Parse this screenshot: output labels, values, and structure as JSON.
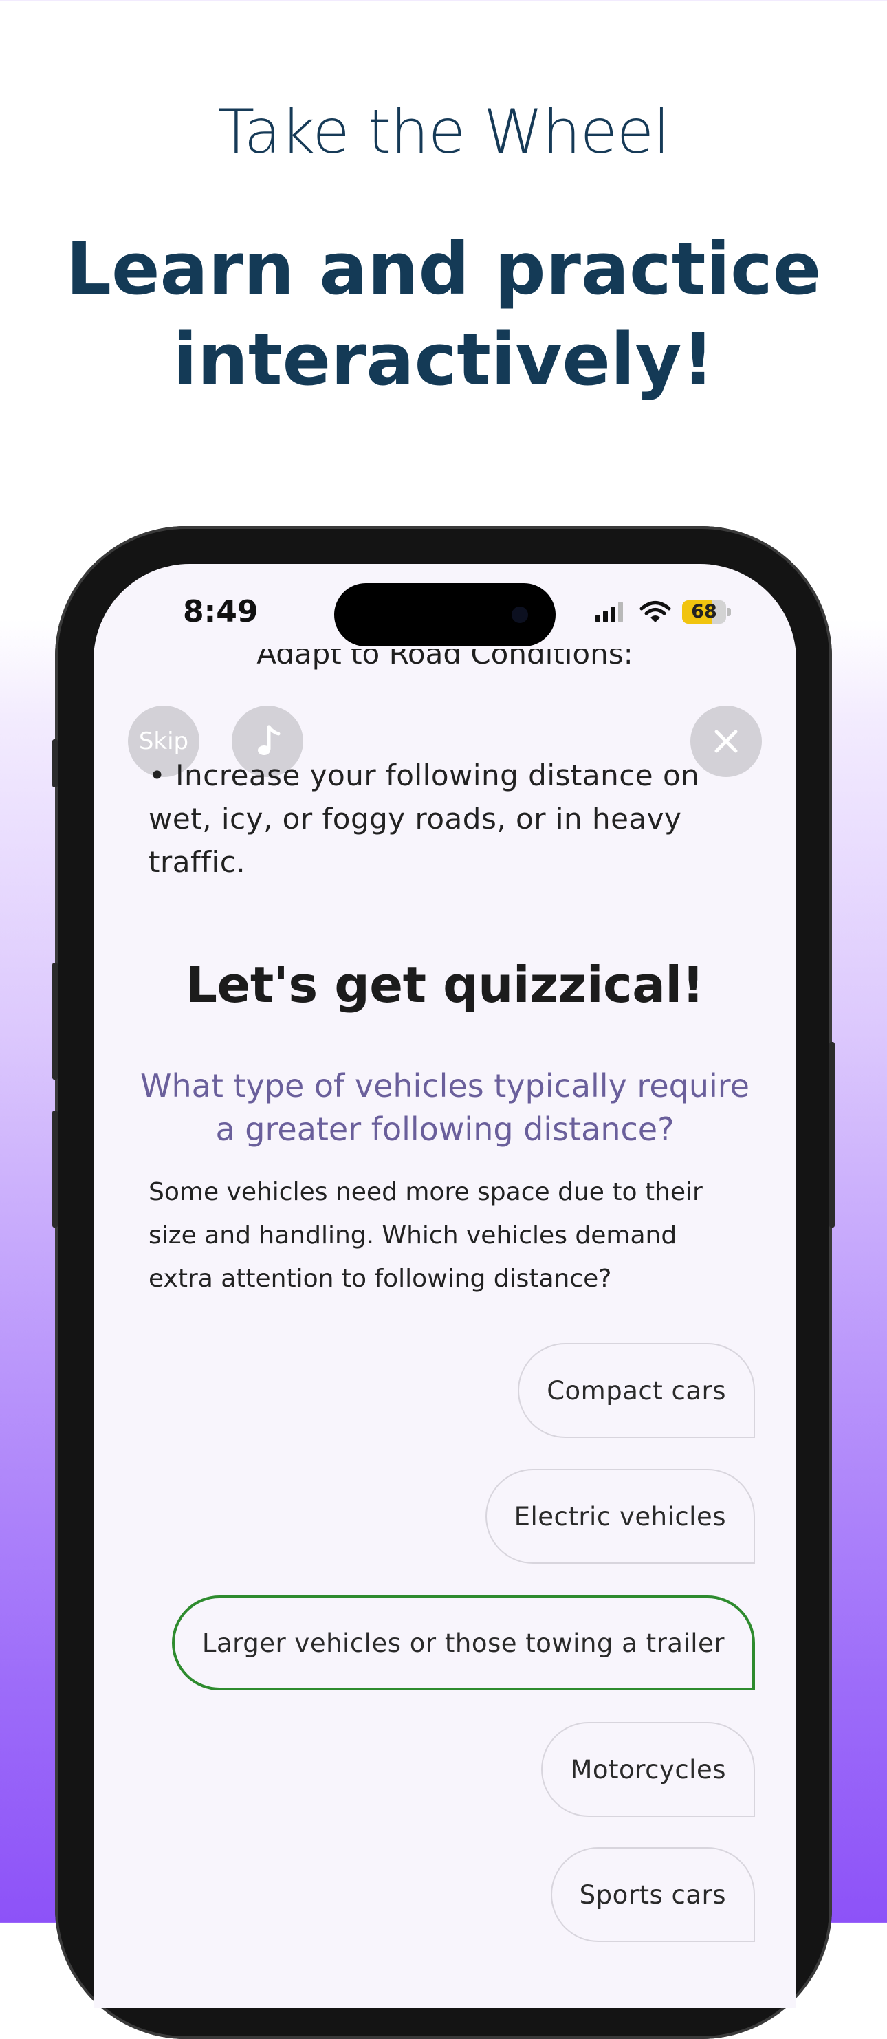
{
  "marketing": {
    "tagline": "Take the Wheel",
    "headline_line1": "Learn and practice",
    "headline_line2": "interactively!"
  },
  "status_bar": {
    "time": "8:49",
    "battery_level": "68",
    "battery_percent": 68,
    "signal_bars_active": 3,
    "signal_bars_total": 4
  },
  "controls": {
    "skip_label": "Skip",
    "music_icon": "music-note-icon",
    "close_icon": "close-icon"
  },
  "lesson": {
    "clipped_heading": "Adapt to Road Conditions:",
    "bullet": "• Increase your following distance on wet, icy, or foggy roads, or in heavy traffic."
  },
  "quiz": {
    "heading": "Let's get quizzical!",
    "question": "What type of vehicles typically require a greater following distance?",
    "description": "Some vehicles need more space due to their size and handling. Which vehicles demand extra attention to following distance?",
    "options": [
      {
        "label": "Compact cars",
        "selected": false
      },
      {
        "label": "Electric vehicles",
        "selected": false
      },
      {
        "label": "Larger vehicles or those towing a trailer",
        "selected": true
      },
      {
        "label": "Motorcycles",
        "selected": false
      },
      {
        "label": "Sports cars",
        "selected": false
      }
    ]
  },
  "colors": {
    "heading_navy": "#143a56",
    "question_purple": "#6a5f9b",
    "correct_green": "#2e8b2e",
    "battery_yellow": "#f1c40f",
    "gradient_bottom": "#8d52f8"
  }
}
